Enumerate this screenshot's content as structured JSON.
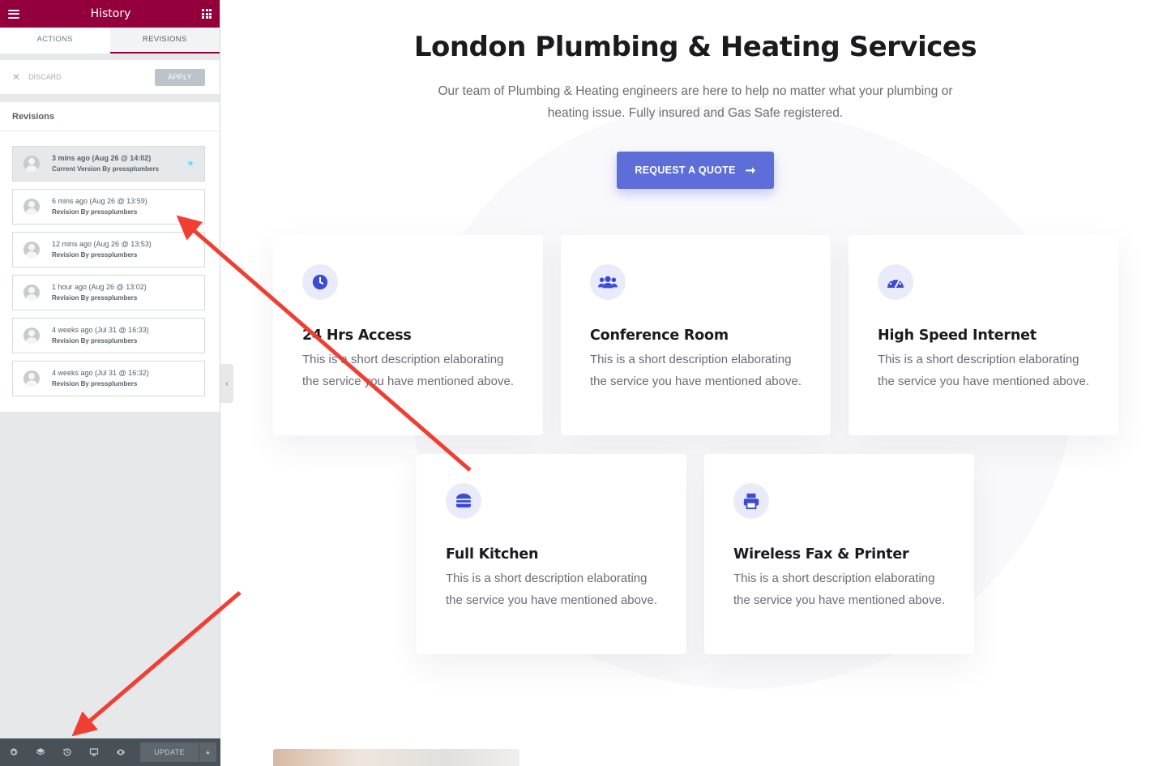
{
  "sidebar": {
    "title": "History",
    "tabs": [
      {
        "label": "ACTIONS",
        "active": false
      },
      {
        "label": "REVISIONS",
        "active": true
      }
    ],
    "discard_label": "DISCARD",
    "apply_label": "APPLY",
    "revisions_heading": "Revisions",
    "revisions": [
      {
        "date": "3 mins ago (Aug 26 @ 14:02)",
        "author": "Current Version By pressplumbers",
        "current": true
      },
      {
        "date": "6 mins ago (Aug 26 @ 13:59)",
        "author": "Revision By pressplumbers"
      },
      {
        "date": "12 mins ago (Aug 26 @ 13:53)",
        "author": "Revision By pressplumbers"
      },
      {
        "date": "1 hour ago (Aug 26 @ 13:02)",
        "author": "Revision By pressplumbers"
      },
      {
        "date": "4 weeks ago (Jul 31 @ 16:33)",
        "author": "Revision By pressplumbers"
      },
      {
        "date": "4 weeks ago (Jul 31 @ 16:32)",
        "author": "Revision By pressplumbers"
      }
    ],
    "footer": {
      "icons": [
        "settings-icon",
        "layers-icon",
        "history-icon",
        "responsive-icon",
        "preview-icon"
      ],
      "update_label": "UPDATE"
    },
    "header_color": "#93003c"
  },
  "main": {
    "title": "London Plumbing & Heating Services",
    "subtitle": "Our team of Plumbing & Heating engineers are here to help no matter what your plumbing or heating issue. Fully insured and Gas Safe registered.",
    "cta_label": "REQUEST A QUOTE",
    "accent": "#5e6ed9",
    "services": [
      {
        "title": "24 Hrs Access",
        "text": "This is a short description elaborating the service you have mentioned above.",
        "icon": "clock-icon"
      },
      {
        "title": "Conference Room",
        "text": "This is a short description elaborating the service you have mentioned above.",
        "icon": "users-icon"
      },
      {
        "title": "High Speed Internet",
        "text": "This is a short description elaborating the service you have mentioned above.",
        "icon": "speedometer-icon"
      },
      {
        "title": "Full Kitchen",
        "text": "This is a short description elaborating the service you have mentioned above.",
        "icon": "burger-icon"
      },
      {
        "title": "Wireless Fax & Printer",
        "text": "This is a short description elaborating the service you have mentioned above.",
        "icon": "printer-icon"
      }
    ]
  },
  "annotation_color": "#f03e33"
}
